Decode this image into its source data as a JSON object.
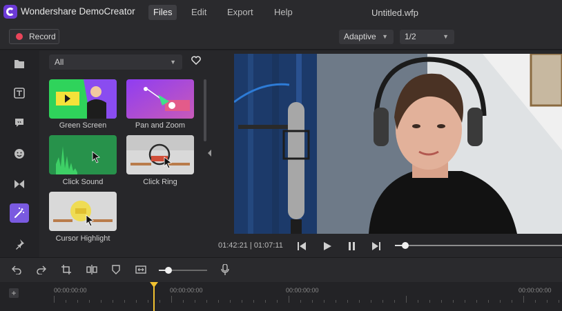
{
  "app": {
    "name": "Wondershare DemoCreator",
    "filename": "Untitled.wfp"
  },
  "menu": [
    "Files",
    "Edit",
    "Export",
    "Help"
  ],
  "toolbar": {
    "record_label": "Record",
    "zoom_mode": "Adaptive",
    "resolution": "1/2"
  },
  "sidebar": {
    "items": [
      {
        "name": "library-files-icon"
      },
      {
        "name": "text-title-icon"
      },
      {
        "name": "annotation-icon"
      },
      {
        "name": "sticker-icon"
      },
      {
        "name": "transition-icon"
      },
      {
        "name": "effects-wand-icon",
        "active": true
      },
      {
        "name": "pin-icon"
      }
    ]
  },
  "library": {
    "filter": "All",
    "effects": [
      {
        "label": "Green Screen"
      },
      {
        "label": "Pan and Zoom"
      },
      {
        "label": "Click Sound"
      },
      {
        "label": "Click Ring"
      },
      {
        "label": "Cursor Highlight"
      }
    ]
  },
  "player": {
    "current_time": "01:42:21",
    "total_time": "01:07:11",
    "progress": 0.06
  },
  "timeline": {
    "zoom": 0.2,
    "ruler_labels": [
      "00:00:00:00",
      "00:00:00:00",
      "00:00:00:00",
      "00:00:00:00"
    ]
  },
  "colors": {
    "accent": "#7a5ae0",
    "record": "#e9455a",
    "playhead": "#f2c230",
    "green": "#3fc96a"
  }
}
